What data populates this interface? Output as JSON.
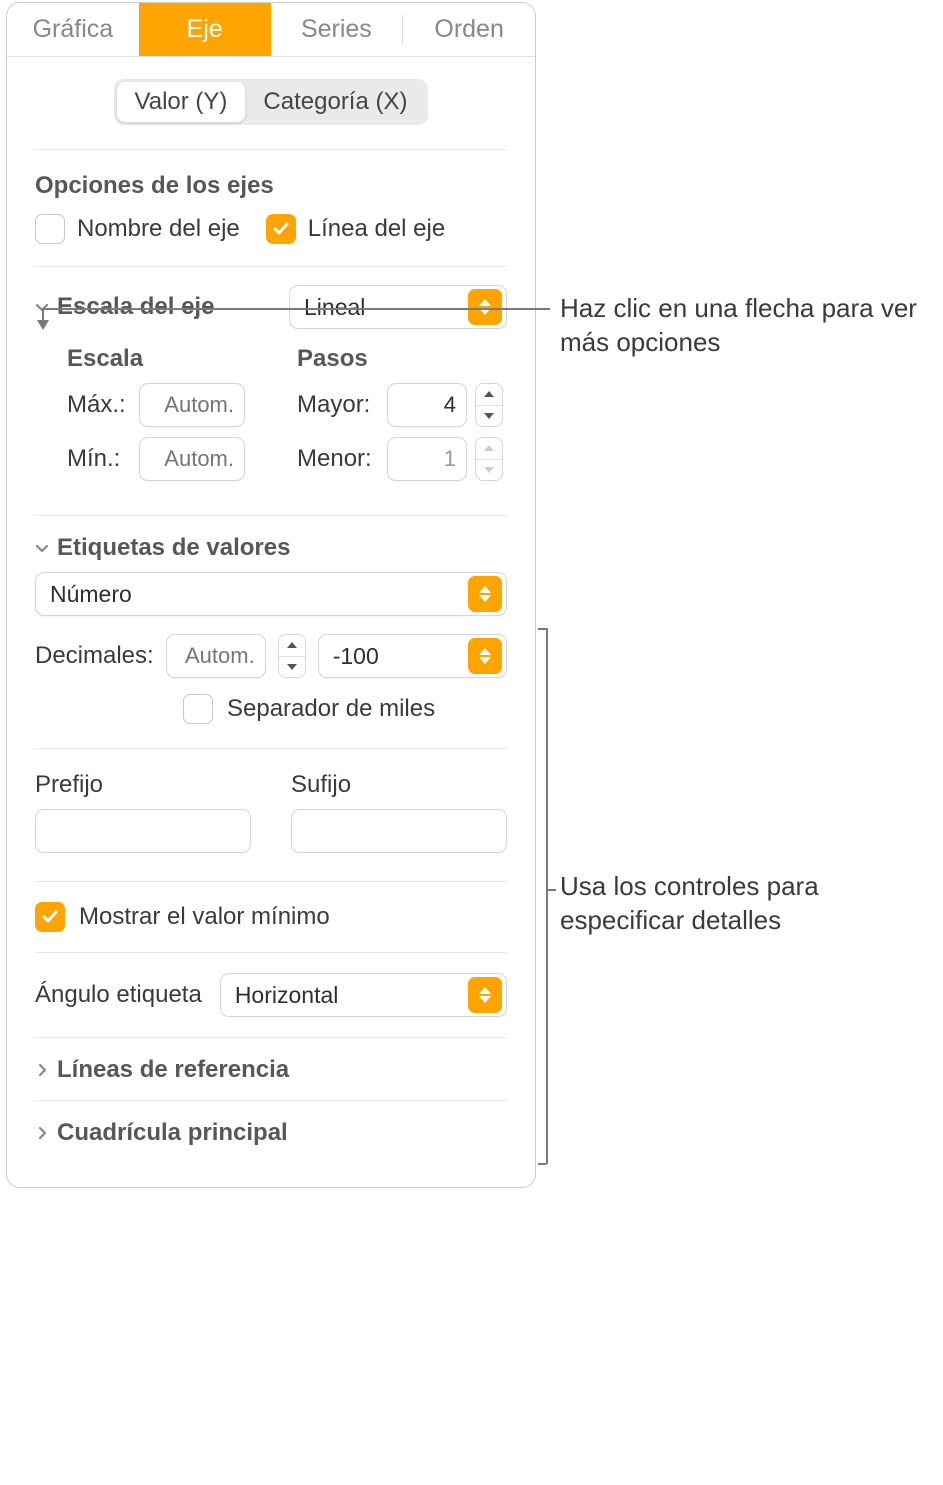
{
  "tabs": {
    "grafica": "Gráfica",
    "eje": "Eje",
    "series": "Series",
    "orden": "Orden"
  },
  "segmented": {
    "valor_y": "Valor (Y)",
    "categoria_x": "Categoría (X)"
  },
  "axis_options": {
    "heading": "Opciones de los ejes",
    "nombre_eje": "Nombre del eje",
    "linea_eje": "Línea del eje"
  },
  "axis_scale": {
    "label": "Escala del eje",
    "value": "Lineal",
    "escala_h": "Escala",
    "pasos_h": "Pasos",
    "max_l": "Máx.:",
    "min_l": "Mín.:",
    "auto_ph": "Autom.",
    "mayor_l": "Mayor:",
    "mayor_v": "4",
    "menor_l": "Menor:",
    "menor_v": "1"
  },
  "value_labels": {
    "heading": "Etiquetas de valores",
    "format": "Número",
    "decimales_l": "Decimales:",
    "decimales_ph": "Autom.",
    "neg_format": "-100",
    "sep_miles": "Separador de miles",
    "prefijo_l": "Prefijo",
    "sufijo_l": "Sufijo",
    "mostrar_min": "Mostrar el valor mínimo",
    "angulo_l": "Ángulo etiqueta",
    "angulo_v": "Horizontal"
  },
  "ref_lines": "Líneas de referencia",
  "grid_main": "Cuadrícula principal",
  "callouts": {
    "c1": "Haz clic en una flecha para ver más opciones",
    "c2": "Usa los controles para especificar detalles"
  }
}
